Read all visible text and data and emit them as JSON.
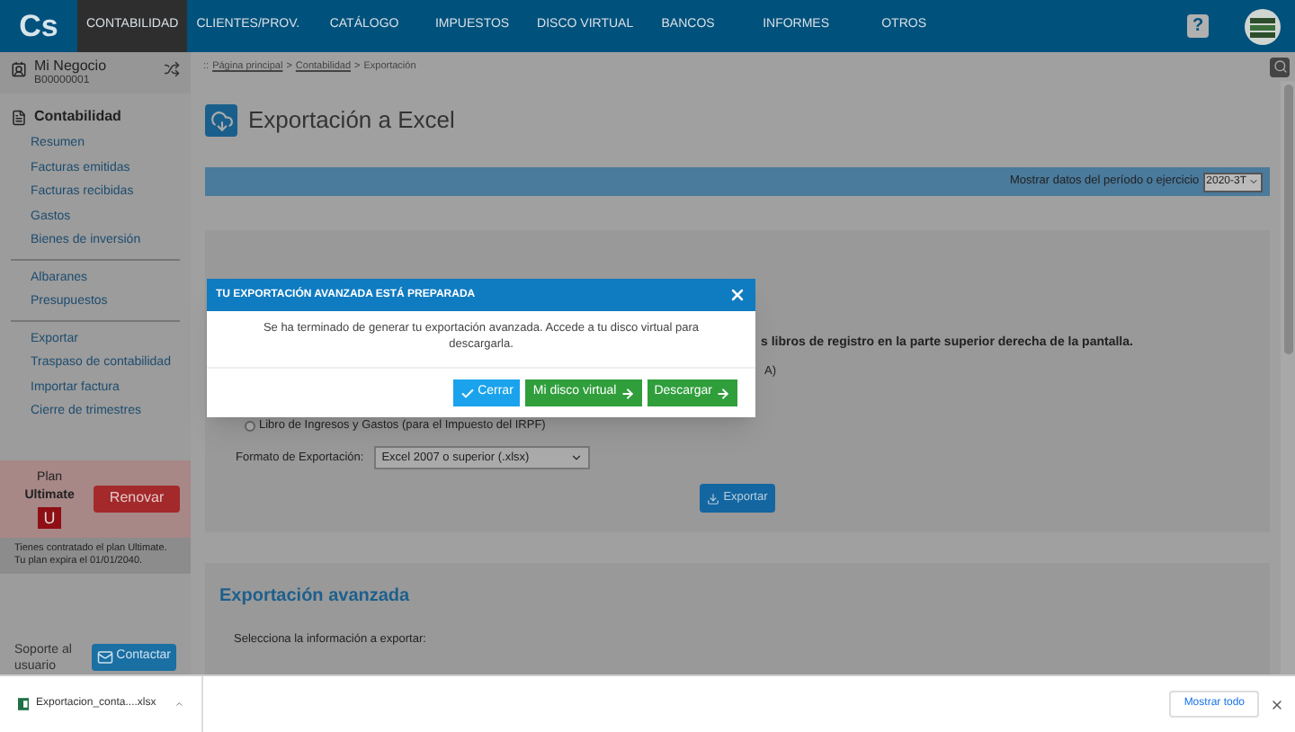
{
  "nav": {
    "logo": "Cs",
    "items": [
      {
        "label": "CONTABILIDAD",
        "selected": true
      },
      {
        "label": "CLIENTES/PROV.",
        "selected": false
      },
      {
        "label": "CATÁLOGO",
        "selected": false
      },
      {
        "label": "IMPUESTOS",
        "selected": false
      },
      {
        "label": "DISCO VIRTUAL",
        "selected": false
      },
      {
        "label": "BANCOS",
        "selected": false
      },
      {
        "label": "INFORMES",
        "selected": false
      },
      {
        "label": "OTROS",
        "selected": false
      }
    ],
    "help": "?"
  },
  "sidebar": {
    "business": {
      "name": "Mi Negocio",
      "id": "B00000001"
    },
    "section": "Contabilidad",
    "groups": [
      {
        "items": [
          "Resumen",
          "Facturas emitidas",
          "Facturas recibidas",
          "Gastos",
          "Bienes de inversión"
        ]
      },
      {
        "items": [
          "Albaranes",
          "Presupuestos"
        ]
      },
      {
        "items": [
          "Exportar",
          "Traspaso de contabilidad",
          "Importar factura",
          "Cierre de trimestres"
        ]
      }
    ],
    "plan": {
      "label": "Plan",
      "name": "Ultimate",
      "badge": "U",
      "button": "Renovar",
      "note": "Tienes contratado el plan Ultimate. Tu plan expira el 01/01/2040."
    },
    "support": {
      "label": "Soporte al usuario",
      "button": "Contactar"
    }
  },
  "breadcrumb": {
    "prefix": "::",
    "items": [
      "Página principal",
      "Contabilidad"
    ],
    "current": "Exportación",
    "separator": ">"
  },
  "page": {
    "title": "Exportación a Excel",
    "period_label": "Mostrar datos del período o ejercicio",
    "period": "2020-3T",
    "section1": {
      "note_fragment": "s libros de registro en la parte superior derecha de la pantalla.",
      "option_fragment": "A)",
      "options": [
        {
          "label": "Libro de Ingresos y Gastos (para el Impuesto del IRPF)",
          "selected": false
        }
      ],
      "format_label": "Formato de Exportación:",
      "format": "Excel 2007 o superior (.xlsx)",
      "button": "Exportar"
    },
    "section2": {
      "title": "Exportación avanzada",
      "prompt": "Selecciona la información a exportar:"
    }
  },
  "modal": {
    "title": "TU EXPORTACIÓN AVANZADA ESTÁ PREPARADA",
    "message": "Se ha terminado de generar tu exportación avanzada. Accede a tu disco virtual para descargarla.",
    "buttons": [
      {
        "label": "Cerrar",
        "kind": "close"
      },
      {
        "label": "Mi disco virtual",
        "kind": "go"
      },
      {
        "label": "Descargar",
        "kind": "go"
      }
    ]
  },
  "downloads": {
    "file": "Exportacion_conta....xlsx",
    "show_all": "Mostrar todo"
  }
}
